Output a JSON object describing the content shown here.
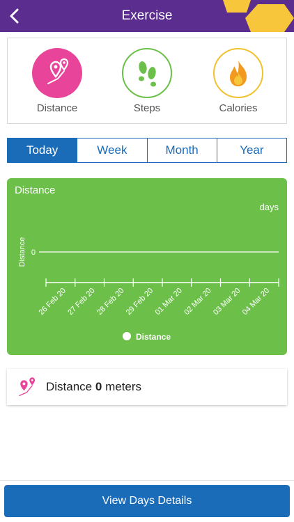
{
  "header": {
    "title": "Exercise",
    "color": "#5b2d8e",
    "accent": "#f7c63a"
  },
  "categories": [
    {
      "label": "Distance",
      "icon": "map-pins-icon",
      "color": "#e8449a"
    },
    {
      "label": "Steps",
      "icon": "footprints-icon",
      "color": "#6cc04a"
    },
    {
      "label": "Calories",
      "icon": "flame-icon",
      "color": "#f2c12e"
    }
  ],
  "tabs": [
    {
      "label": "Today",
      "active": true
    },
    {
      "label": "Week",
      "active": false
    },
    {
      "label": "Month",
      "active": false
    },
    {
      "label": "Year",
      "active": false
    }
  ],
  "chart_data": {
    "type": "line",
    "title": "Distance",
    "xlabel": "days",
    "ylabel": "Distance",
    "categories": [
      "26 Feb 20",
      "27 Feb 20",
      "28 Feb 20",
      "29 Feb 20",
      "01 Mar 20",
      "02 Mar 20",
      "03 Mar 20",
      "04 Mar 20"
    ],
    "series": [
      {
        "name": "Distance",
        "values": [
          0,
          0,
          0,
          0,
          0,
          0,
          0,
          0
        ]
      }
    ],
    "yticks": [
      "0"
    ],
    "ylim": [
      0,
      1
    ],
    "grid": false,
    "legend": "bottom",
    "background": "#6cc04a"
  },
  "summary": {
    "label": "Distance",
    "value": "0",
    "unit": "meters"
  },
  "footer": {
    "button_label": "View Days Details"
  }
}
